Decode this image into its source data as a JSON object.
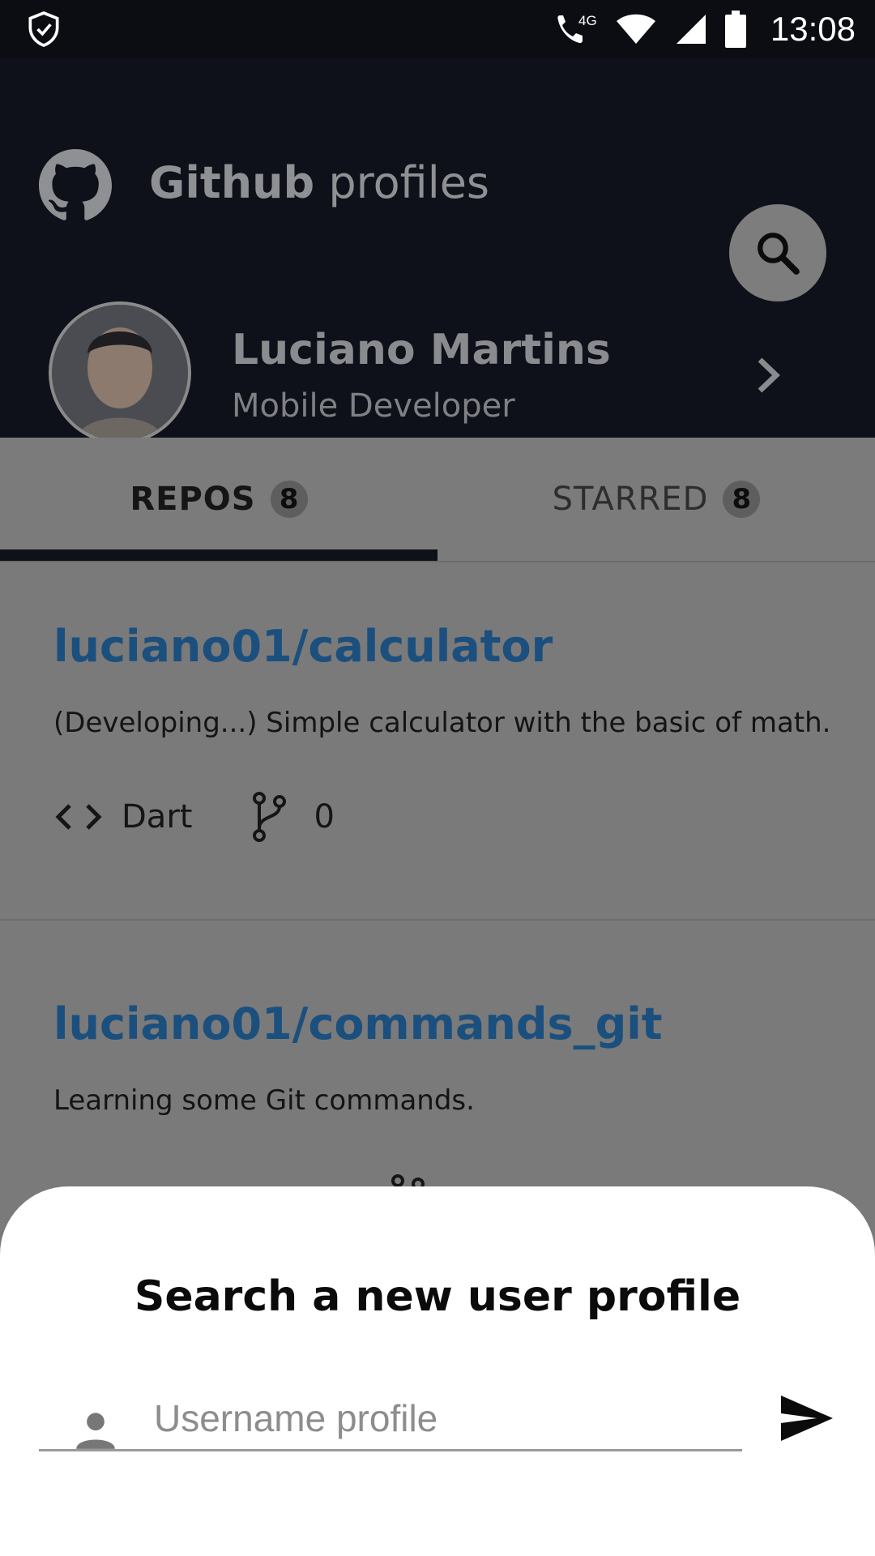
{
  "status_bar": {
    "time": "13:08",
    "network_label": "4G",
    "icons": [
      "shield-check-icon",
      "wifi-call-icon",
      "wifi-icon",
      "cell-signal-icon",
      "battery-icon"
    ]
  },
  "header": {
    "title_bold": "Github",
    "title_regular": " profiles",
    "user_name": "Luciano Martins",
    "user_role": "Mobile Developer"
  },
  "tabs": [
    {
      "label": "REPOS",
      "count": "8",
      "selected": true
    },
    {
      "label": "STARRED",
      "count": "8",
      "selected": false
    }
  ],
  "repos": [
    {
      "name": "luciano01/calculator",
      "description": "(Developing...) Simple calculator with the basic of math.",
      "language": "Dart",
      "forks": "0"
    },
    {
      "name": "luciano01/commands_git",
      "description": "Learning some Git commands."
    }
  ],
  "sheet": {
    "title": "Search a new user profile",
    "input_placeholder": "Username profile",
    "input_value": ""
  },
  "colors": {
    "header_bg": "#0e1119",
    "repo_link": "#1b4f7e",
    "scrim": "#7a7a7a",
    "sheet_bg": "#ffffff"
  }
}
